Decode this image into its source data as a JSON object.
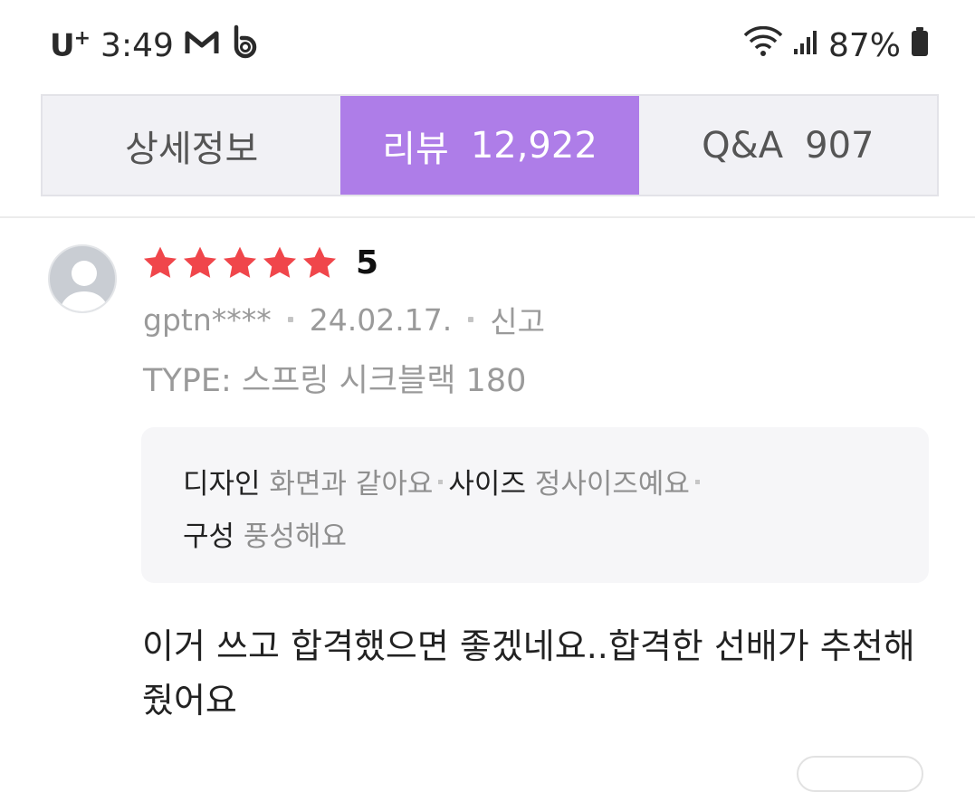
{
  "status_bar": {
    "carrier": "U",
    "carrier_plus": "+",
    "time": "3:49",
    "battery": "87%",
    "icons": [
      "gmail-icon",
      "b-app-icon",
      "wifi-icon",
      "signal-icon",
      "battery-icon"
    ]
  },
  "tabs": [
    {
      "label": "상세정보",
      "count": "",
      "active": false
    },
    {
      "label": "리뷰",
      "count": "12,922",
      "active": true
    },
    {
      "label": "Q&A",
      "count": "907",
      "active": false
    }
  ],
  "review": {
    "rating": 5,
    "rating_label": "5",
    "author": "gptn****",
    "date": "24.02.17.",
    "report_label": "신고",
    "option": "TYPE: 스프링 시크블랙 180",
    "survey": [
      {
        "key": "디자인",
        "value": "화면과 같아요"
      },
      {
        "key": "사이즈",
        "value": "정사이즈예요"
      },
      {
        "key": "구성",
        "value": "풍성해요"
      }
    ],
    "text": "이거 쓰고 합격했으면 좋겠네요..합격한 선배가 추천해줬어요"
  },
  "colors": {
    "accent": "#ae7de8",
    "star": "#f0464b",
    "tab_bg": "#f1f1f5"
  }
}
